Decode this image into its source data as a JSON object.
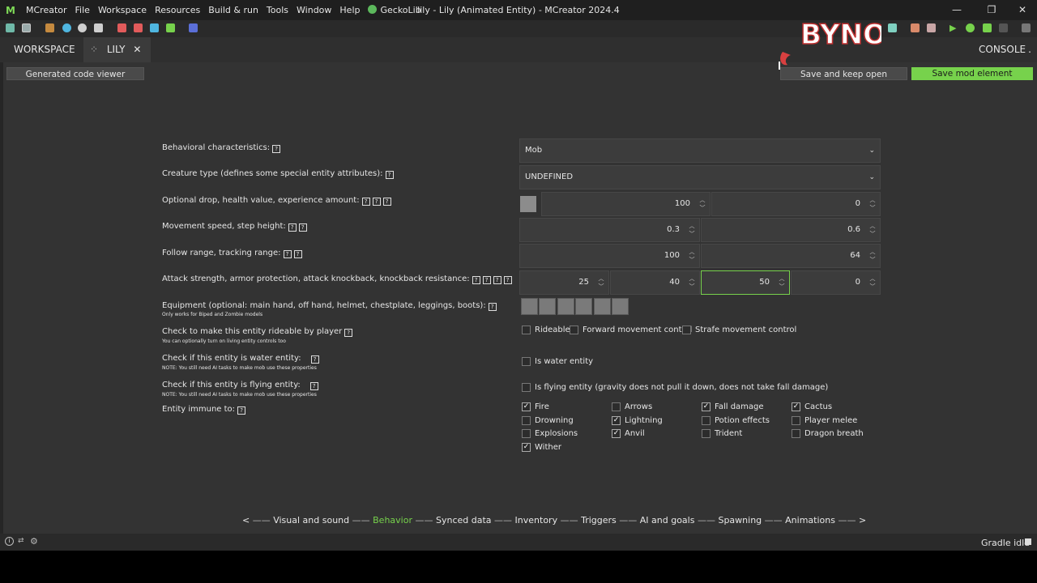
{
  "app": {
    "menu": [
      "MCreator",
      "File",
      "Workspace",
      "Resources",
      "Build & run",
      "Tools",
      "Window",
      "Help",
      "GeckoLib"
    ],
    "window_title": "lily - Lily (Animated Entity) - MCreator 2024.4",
    "win_buttons": [
      "—",
      "❐",
      "✕"
    ]
  },
  "tabs": {
    "workspace": "WORKSPACE",
    "lily": "LILY",
    "close": "✕",
    "console": "CONSOLE"
  },
  "buttons": {
    "code_viewer": "Generated code viewer",
    "save_keep_open": "Save and keep open",
    "save_mod_element": "Save mod element"
  },
  "watermark": "BYNO",
  "form": {
    "behavioral": {
      "label": "Behavioral characteristics:",
      "value": "Mob"
    },
    "creature_type": {
      "label": "Creature type (defines some special entity attributes):",
      "value": "UNDEFINED"
    },
    "drop": {
      "label": "Optional drop, health value, experience amount:",
      "health": "100",
      "xp": "0"
    },
    "movement": {
      "label": "Movement speed, step height:",
      "speed": "0.3",
      "step": "0.6"
    },
    "follow": {
      "label": "Follow range, tracking range:",
      "follow": "100",
      "tracking": "64"
    },
    "attack": {
      "label": "Attack strength, armor protection, attack knockback, knockback resistance:",
      "strength": "25",
      "armor": "40",
      "knockback": "50",
      "resistance": "0"
    },
    "equipment": {
      "label": "Equipment (optional: main hand, off hand, helmet, chestplate, leggings, boots):",
      "note": "Only works for Biped and Zombie models"
    },
    "rideable": {
      "label": "Check to make this entity rideable by player",
      "note": "You can optionally turn on living entity controls too",
      "options": [
        {
          "label": "Rideable",
          "checked": false
        },
        {
          "label": "Forward movement control",
          "checked": false
        },
        {
          "label": "Strafe movement control",
          "checked": false
        }
      ]
    },
    "water": {
      "label": "Check if this entity is water entity:",
      "note": "NOTE: You still need AI tasks to make mob use these properties",
      "option": "Is water entity",
      "checked": false
    },
    "flying": {
      "label": "Check if this entity is flying entity:",
      "note": "NOTE: You still need AI tasks to make mob use these properties",
      "option": "Is flying entity (gravity does not pull it down, does not take fall damage)",
      "checked": false
    },
    "immune": {
      "label": "Entity immune to:",
      "items": [
        {
          "label": "Fire",
          "checked": true
        },
        {
          "label": "Arrows",
          "checked": false
        },
        {
          "label": "Fall damage",
          "checked": true
        },
        {
          "label": "Cactus",
          "checked": true
        },
        {
          "label": "Drowning",
          "checked": false
        },
        {
          "label": "Lightning",
          "checked": true
        },
        {
          "label": "Potion effects",
          "checked": false
        },
        {
          "label": "Player melee",
          "checked": false
        },
        {
          "label": "Explosions",
          "checked": false
        },
        {
          "label": "Anvil",
          "checked": true
        },
        {
          "label": "Trident",
          "checked": false
        },
        {
          "label": "Dragon breath",
          "checked": false
        },
        {
          "label": "Wither",
          "checked": true
        }
      ]
    }
  },
  "help_mark": "?",
  "check_mark": "✓",
  "pages": {
    "prev": "<",
    "next": ">",
    "items": [
      "Visual and sound",
      "Behavior",
      "Synced data",
      "Inventory",
      "Triggers",
      "AI and goals",
      "Spawning",
      "Animations"
    ],
    "current": "Behavior"
  },
  "status": {
    "gradle": "Gradle idle"
  },
  "colors": {
    "accent": "#77d24c",
    "panel": "#333333"
  }
}
